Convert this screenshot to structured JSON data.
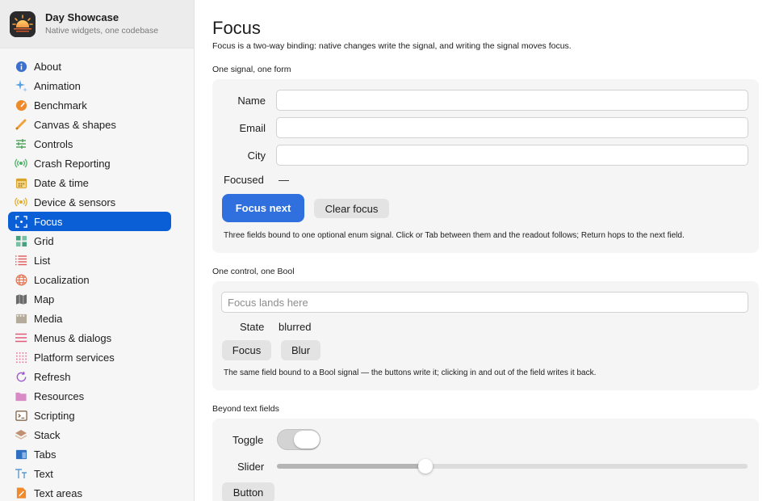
{
  "app": {
    "title": "Day Showcase",
    "subtitle": "Native widgets, one codebase",
    "accent": "#0a5fd7"
  },
  "sidebar": {
    "items": [
      {
        "label": "About",
        "icon": "info-icon",
        "color": "#3d6fcf"
      },
      {
        "label": "Animation",
        "icon": "sparkles-icon",
        "color": "#5aa0e0"
      },
      {
        "label": "Benchmark",
        "icon": "gauge-icon",
        "color": "#ef8a2a"
      },
      {
        "label": "Canvas & shapes",
        "icon": "pencil-icon",
        "color": "#f0a23a"
      },
      {
        "label": "Controls",
        "icon": "sliders-icon",
        "color": "#4aa05a"
      },
      {
        "label": "Crash Reporting",
        "icon": "broadcast-icon",
        "color": "#4fb36a"
      },
      {
        "label": "Date & time",
        "icon": "calendar-icon",
        "color": "#d9a32a"
      },
      {
        "label": "Device & sensors",
        "icon": "sensor-icon",
        "color": "#e0b030"
      },
      {
        "label": "Focus",
        "icon": "focus-icon",
        "color": "#ffffff",
        "active": true
      },
      {
        "label": "Grid",
        "icon": "grid-icon",
        "color": "#4aa080"
      },
      {
        "label": "List",
        "icon": "list-icon",
        "color": "#e05a5a"
      },
      {
        "label": "Localization",
        "icon": "globe-icon",
        "color": "#e07050"
      },
      {
        "label": "Map",
        "icon": "map-icon",
        "color": "#555555"
      },
      {
        "label": "Media",
        "icon": "film-icon",
        "color": "#9a9080"
      },
      {
        "label": "Menus & dialogs",
        "icon": "menu-icon",
        "color": "#e05a7a"
      },
      {
        "label": "Platform services",
        "icon": "dots-grid-icon",
        "color": "#e07aa0"
      },
      {
        "label": "Refresh",
        "icon": "refresh-icon",
        "color": "#a05ad0"
      },
      {
        "label": "Resources",
        "icon": "folder-icon",
        "color": "#d080c0"
      },
      {
        "label": "Scripting",
        "icon": "terminal-icon",
        "color": "#7a5a3a"
      },
      {
        "label": "Stack",
        "icon": "layers-icon",
        "color": "#c09070"
      },
      {
        "label": "Tabs",
        "icon": "tabs-icon",
        "color": "#2f6fbf"
      },
      {
        "label": "Text",
        "icon": "text-icon",
        "color": "#5a9ad0"
      },
      {
        "label": "Text areas",
        "icon": "text-area-icon",
        "color": "#f08a2a"
      }
    ]
  },
  "page": {
    "title": "Focus",
    "description": "Focus is a two-way binding: native changes write the signal, and writing the signal moves focus."
  },
  "section1": {
    "title": "One signal, one form",
    "fields": [
      {
        "label": "Name",
        "value": ""
      },
      {
        "label": "Email",
        "value": ""
      },
      {
        "label": "City",
        "value": ""
      }
    ],
    "focused_label": "Focused",
    "focused_value": "—",
    "focus_next_label": "Focus next",
    "clear_focus_label": "Clear focus",
    "note": "Three fields bound to one optional enum signal. Click or Tab between them and the readout follows; Return hops to the next field."
  },
  "section2": {
    "title": "One control, one Bool",
    "placeholder": "Focus lands here",
    "state_label": "State",
    "state_value": "blurred",
    "focus_label": "Focus",
    "blur_label": "Blur",
    "note": "The same field bound to a Bool signal — the buttons write it; clicking in and out of the field writes it back."
  },
  "section3": {
    "title": "Beyond text fields",
    "toggle_label": "Toggle",
    "toggle_on": false,
    "slider_label": "Slider",
    "slider_value": 0.31,
    "button_label": "Button"
  }
}
